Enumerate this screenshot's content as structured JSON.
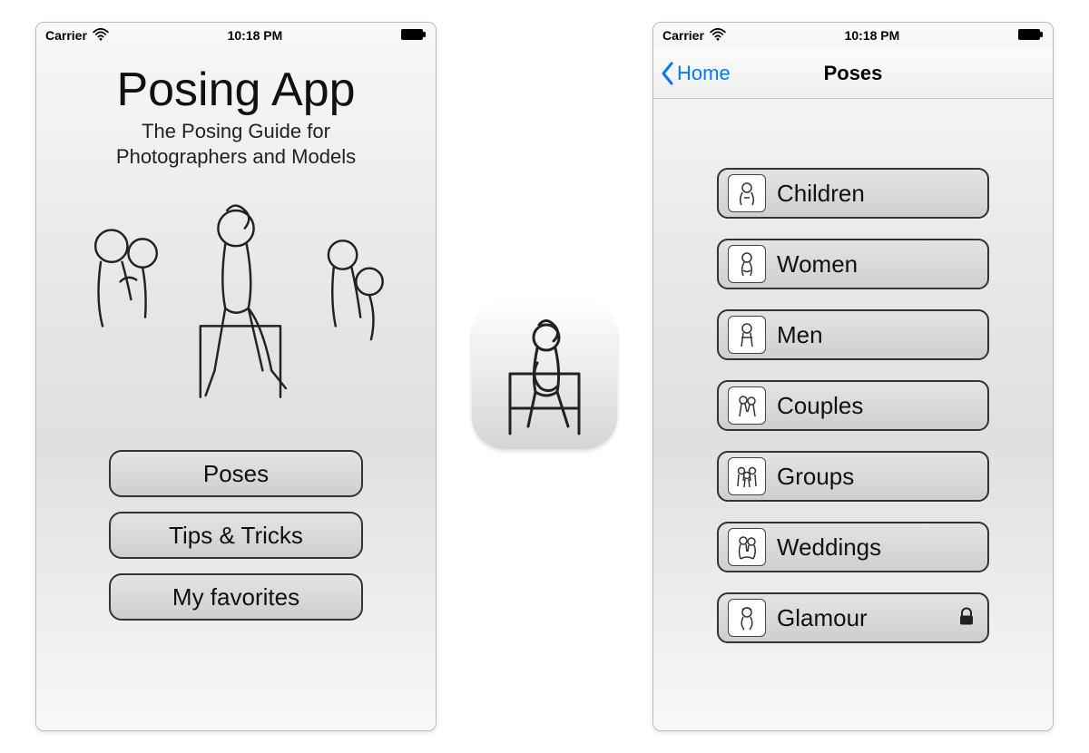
{
  "status": {
    "carrier": "Carrier",
    "time": "10:18 PM"
  },
  "home": {
    "title": "Posing App",
    "subtitle_line1": "The Posing Guide for",
    "subtitle_line2": "Photographers and Models",
    "buttons": {
      "poses": "Poses",
      "tips": "Tips & Tricks",
      "favorites": "My favorites"
    }
  },
  "poses_screen": {
    "back_label": "Home",
    "title": "Poses",
    "categories": [
      {
        "label": "Children",
        "locked": false
      },
      {
        "label": "Women",
        "locked": false
      },
      {
        "label": "Men",
        "locked": false
      },
      {
        "label": "Couples",
        "locked": false
      },
      {
        "label": "Groups",
        "locked": false
      },
      {
        "label": "Weddings",
        "locked": false
      },
      {
        "label": "Glamour",
        "locked": true
      }
    ]
  }
}
